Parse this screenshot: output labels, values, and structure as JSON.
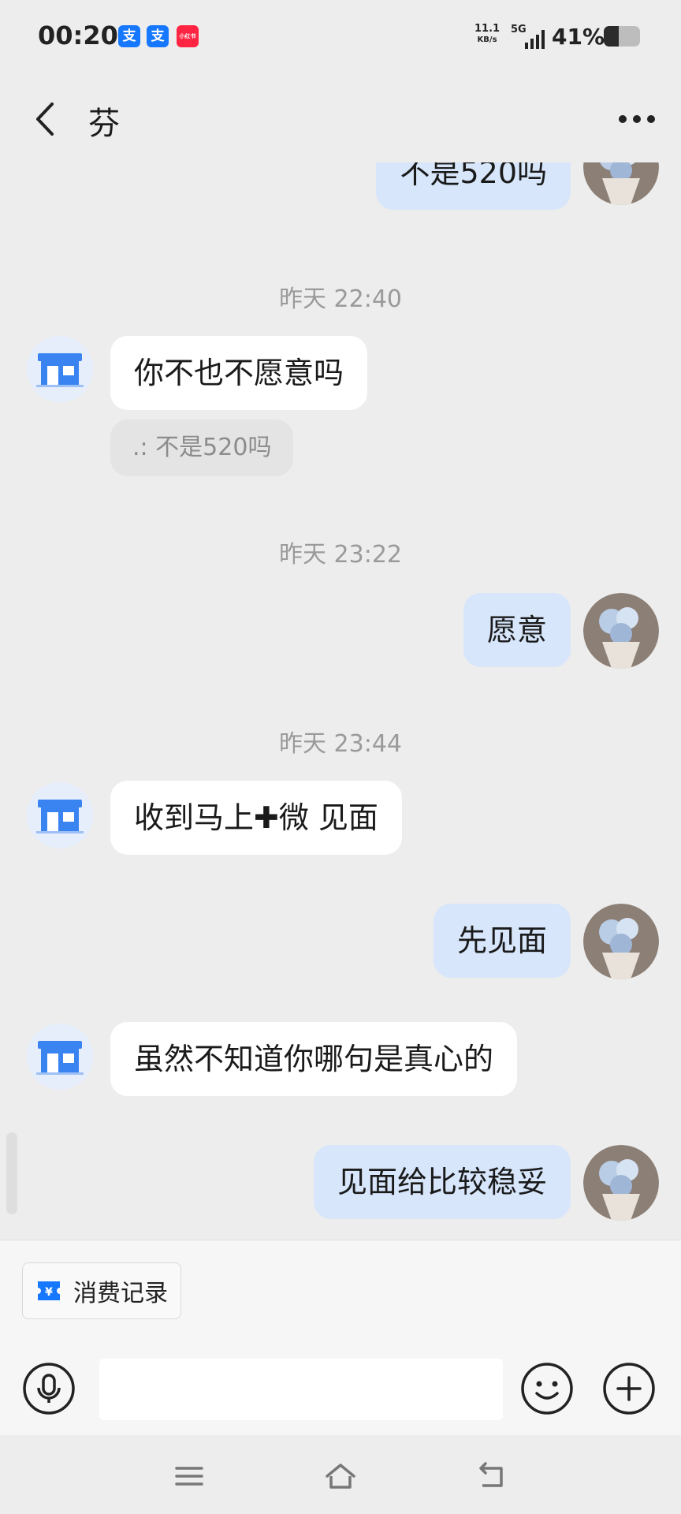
{
  "status_bar": {
    "time": "00:20",
    "app_icons": [
      {
        "icon": "alipay-icon",
        "glyph": "支",
        "color": "#1677ff"
      },
      {
        "icon": "alipay-icon",
        "glyph": "支",
        "color": "#1677ff"
      },
      {
        "icon": "xiaohongshu-icon",
        "glyph": "小红书",
        "color": "#ff2442"
      }
    ],
    "net_speed": "11.1",
    "net_unit": "KB/s",
    "network_type": "5G",
    "battery_text": "41%",
    "battery_level": 0.41
  },
  "header": {
    "title": "芬",
    "back_icon": "chevron-left-icon",
    "more_icon": "more-icon"
  },
  "messages": [
    {
      "type": "out",
      "text": "不是520吗"
    },
    {
      "type": "timestamp",
      "text": "昨天 22:40"
    },
    {
      "type": "in",
      "text": "你不也不愿意吗",
      "quote": ".:  不是520吗"
    },
    {
      "type": "timestamp",
      "text": "昨天 23:22"
    },
    {
      "type": "out",
      "text": "愿意"
    },
    {
      "type": "timestamp",
      "text": "昨天 23:44"
    },
    {
      "type": "in",
      "text": "收到马上✚微 见面"
    },
    {
      "type": "out",
      "text": "先见面"
    },
    {
      "type": "in",
      "text": "虽然不知道你哪句是真心的"
    },
    {
      "type": "out",
      "text": "见面给比较稳妥"
    }
  ],
  "bottom": {
    "consume_records_label": "消费记录",
    "input_value": "",
    "voice_icon": "microphone-icon",
    "emoji_icon": "emoji-icon",
    "plus_icon": "plus-circle-icon"
  },
  "nav_bar": {
    "menu_icon": "menu-icon",
    "home_icon": "home-icon",
    "back_icon": "back-arrow-icon"
  },
  "colors": {
    "background": "#ededed",
    "incoming_bubble": "#ffffff",
    "outgoing_bubble": "#d7e6fb",
    "shop_avatar_blue": "#3a84f2"
  }
}
